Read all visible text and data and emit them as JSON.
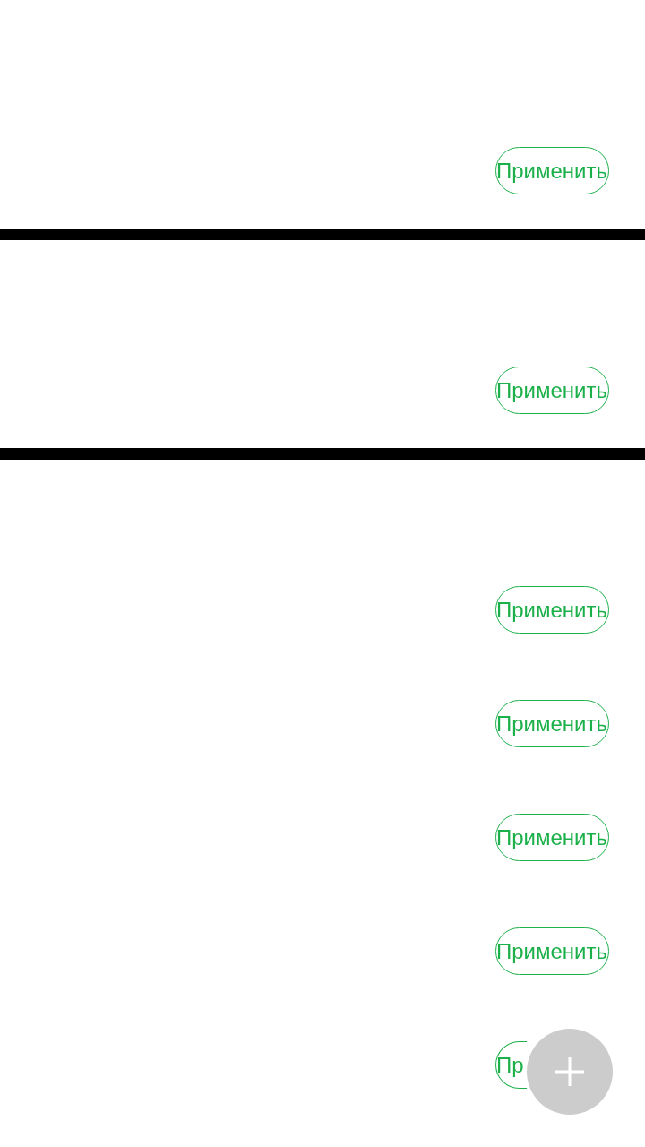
{
  "panels": [
    {
      "apply_button": "Применить"
    },
    {
      "apply_button": "Применить"
    }
  ],
  "list": [
    {
      "apply_button": "Применить"
    },
    {
      "apply_button": "Применить"
    },
    {
      "apply_button": "Применить"
    },
    {
      "apply_button": "Применить"
    },
    {
      "apply_button": "Пр"
    }
  ]
}
